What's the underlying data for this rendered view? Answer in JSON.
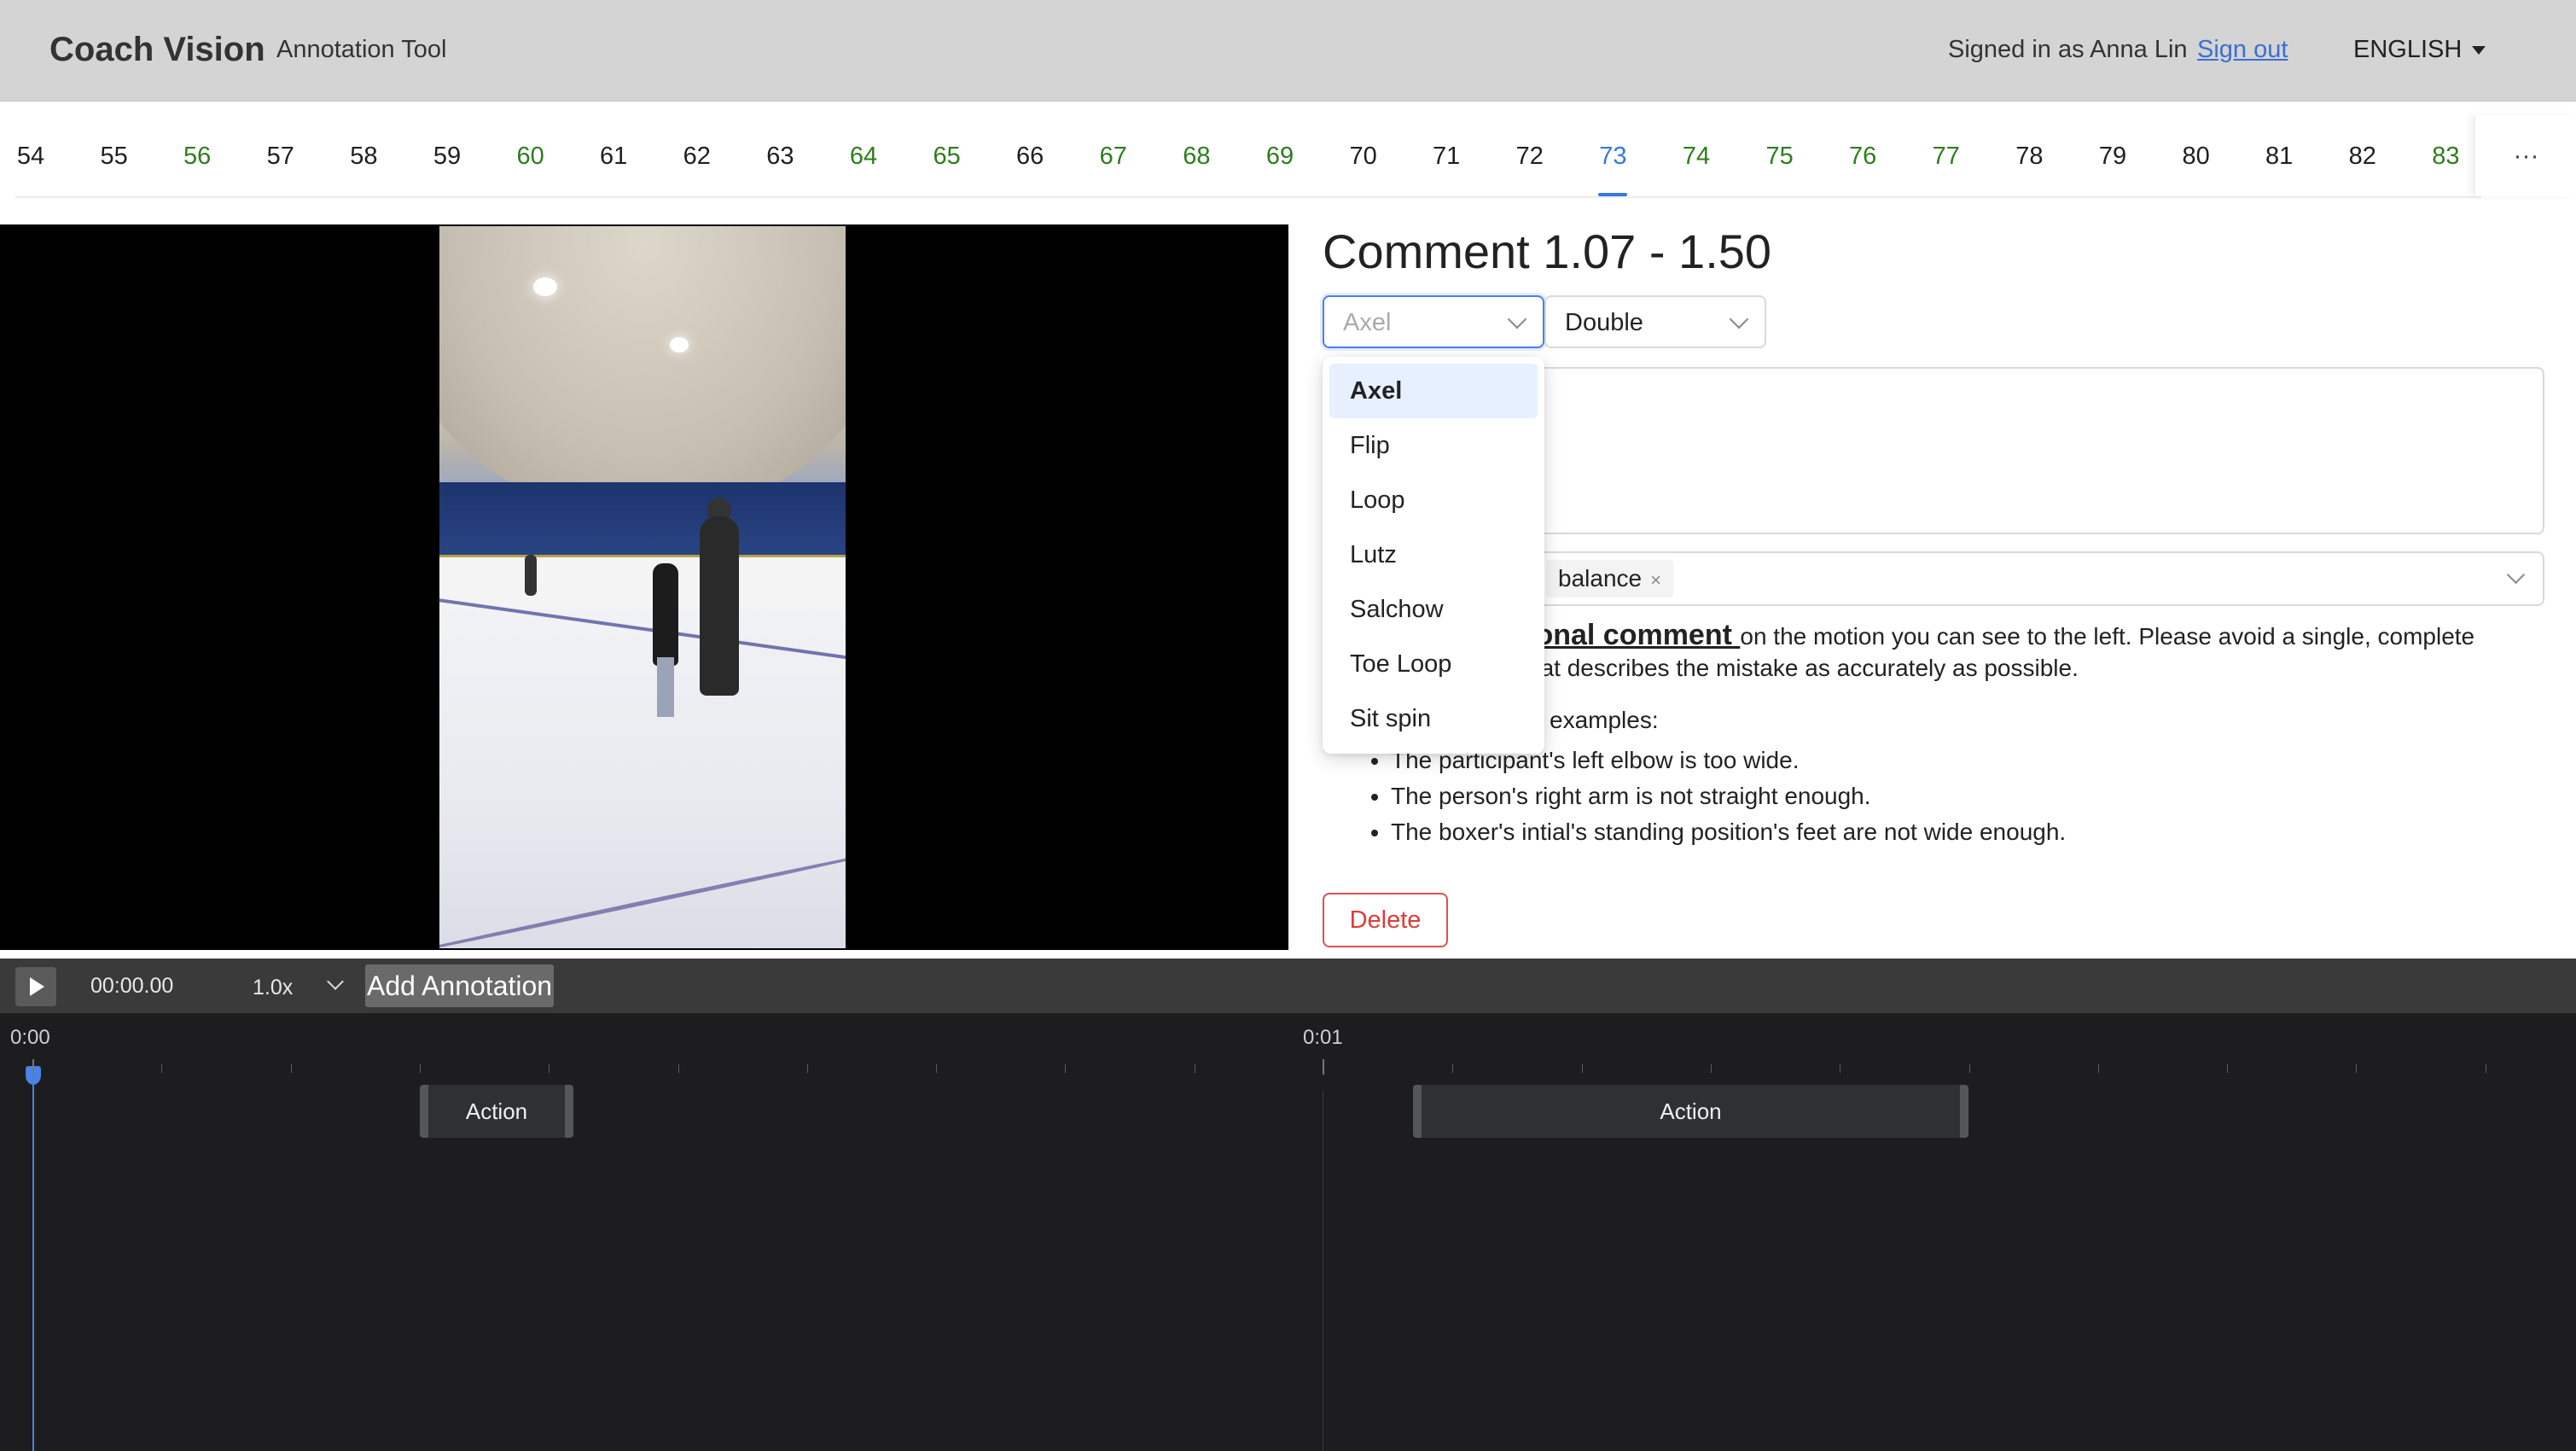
{
  "header": {
    "brand": "Coach Vision",
    "subtitle": "Annotation Tool",
    "signed_in_text": "Signed in as Anna Lin",
    "sign_out": "Sign out",
    "language": "ENGLISH"
  },
  "number_tabs": {
    "items": [
      {
        "label": "54",
        "done": false
      },
      {
        "label": "55",
        "done": false
      },
      {
        "label": "56",
        "done": true
      },
      {
        "label": "57",
        "done": false
      },
      {
        "label": "58",
        "done": false
      },
      {
        "label": "59",
        "done": false
      },
      {
        "label": "60",
        "done": true
      },
      {
        "label": "61",
        "done": false
      },
      {
        "label": "62",
        "done": false
      },
      {
        "label": "63",
        "done": false
      },
      {
        "label": "64",
        "done": true
      },
      {
        "label": "65",
        "done": true
      },
      {
        "label": "66",
        "done": false
      },
      {
        "label": "67",
        "done": true
      },
      {
        "label": "68",
        "done": true
      },
      {
        "label": "69",
        "done": true
      },
      {
        "label": "70",
        "done": false
      },
      {
        "label": "71",
        "done": false
      },
      {
        "label": "72",
        "done": false
      },
      {
        "label": "73",
        "done": false
      },
      {
        "label": "74",
        "done": true
      },
      {
        "label": "75",
        "done": true
      },
      {
        "label": "76",
        "done": true
      },
      {
        "label": "77",
        "done": true
      },
      {
        "label": "78",
        "done": false
      },
      {
        "label": "79",
        "done": false
      },
      {
        "label": "80",
        "done": false
      },
      {
        "label": "81",
        "done": false
      },
      {
        "label": "82",
        "done": false
      },
      {
        "label": "83",
        "done": true
      }
    ],
    "active": "73",
    "more_label": "···"
  },
  "comment": {
    "title": "Comment 1.07 - 1.50",
    "jump_select": {
      "value": "Axel"
    },
    "rotation_select": {
      "value": "Double"
    },
    "tag": "balance",
    "tag_remove": "×",
    "instruction_bold": "ional comment ",
    "instruction_rest": "on the motion you can see to the left. Please avoid a single, complete",
    "instruction_line2": "hat describes the mistake as accurately as possible.",
    "examples_label": "examples:",
    "examples": [
      "The participant's left elbow is too wide.",
      "The person's right arm is not straight enough.",
      "The boxer's intial's standing position's feet are not wide enough."
    ],
    "delete_label": "Delete"
  },
  "dropdown": {
    "options": [
      "Axel",
      "Flip",
      "Loop",
      "Lutz",
      "Salchow",
      "Toe Loop",
      "Sit spin"
    ],
    "selected": "Axel"
  },
  "player": {
    "time": "00:00.00",
    "speed": "1.0x",
    "add_annotation": "Add Annotation"
  },
  "timeline": {
    "labels": [
      "0:00",
      "0:01"
    ],
    "segments": [
      {
        "label": "Action"
      },
      {
        "label": "Action"
      }
    ]
  },
  "colors": {
    "done": "#2d7d1c",
    "active": "#3479e0",
    "danger": "#e03b3b"
  }
}
